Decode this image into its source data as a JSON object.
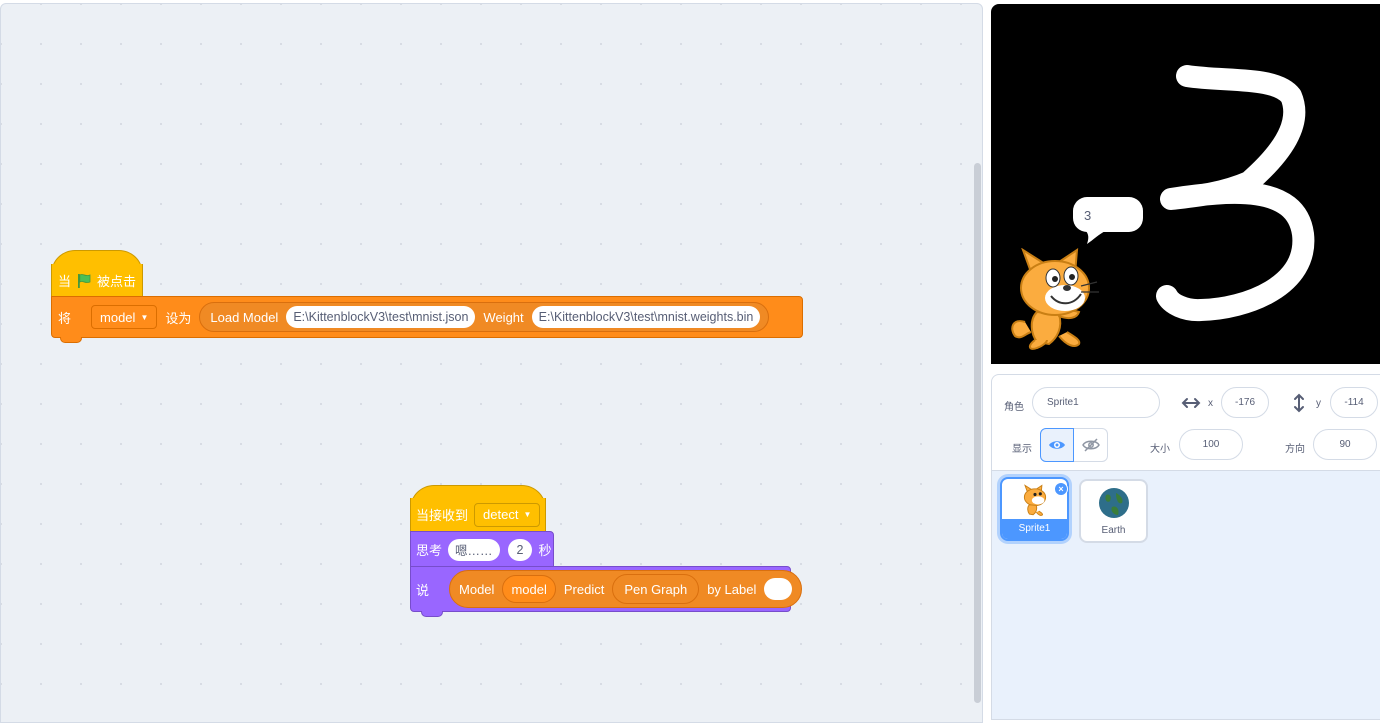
{
  "workspace": {
    "script1": {
      "hat_prefix": "当",
      "hat_suffix": "被点击",
      "set_label": "将",
      "variable": "model",
      "set_to_label": "设为",
      "load_model_label": "Load Model",
      "model_path": "E:\\KittenblockV3\\test\\mnist.json",
      "weight_label": "Weight",
      "weight_path": "E:\\KittenblockV3\\test\\mnist.weights.bin"
    },
    "script2": {
      "hat_label": "当接收到",
      "message": "detect",
      "think_label": "思考",
      "think_text": "嗯……",
      "think_secs": "2",
      "secs_label": "秒",
      "say_label": "说",
      "model_label": "Model",
      "model_var": "model",
      "predict_label": "Predict",
      "pen_graph_label": "Pen Graph",
      "by_label": "by Label"
    }
  },
  "stage": {
    "speech_text": "3"
  },
  "sprite_info": {
    "sprite_label": "角色",
    "sprite_name": "Sprite1",
    "x_label": "x",
    "x_value": "-176",
    "y_label": "y",
    "y_value": "-114",
    "show_label": "显示",
    "size_label": "大小",
    "size_value": "100",
    "direction_label": "方向",
    "direction_value": "90"
  },
  "sprites": [
    {
      "name": "Sprite1",
      "selected": true
    },
    {
      "name": "Earth",
      "selected": false
    }
  ],
  "colors": {
    "events": "#ffbf00",
    "variables": "#ff8c1a",
    "looks": "#9966ff",
    "selected": "#4c97ff"
  }
}
